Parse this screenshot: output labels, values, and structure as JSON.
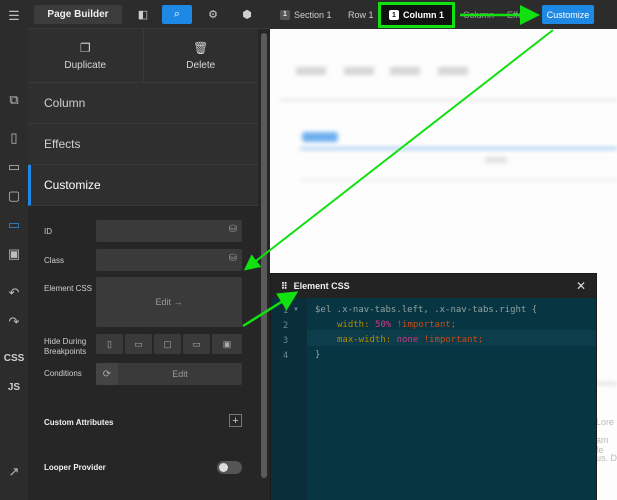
{
  "toolbar": {
    "title": "Page Builder"
  },
  "panel": {
    "actions": [
      {
        "label": "Duplicate",
        "icon": "duplicate-icon"
      },
      {
        "label": "Delete",
        "icon": "trash-icon"
      }
    ],
    "sections": [
      {
        "label": "Column"
      },
      {
        "label": "Effects"
      },
      {
        "label": "Customize"
      }
    ],
    "customize": {
      "id_label": "ID",
      "class_label": "Class",
      "css_label": "Element CSS",
      "css_edit": "Edit →",
      "hide_label": "Hide During Breakpoints",
      "conditions_label": "Conditions",
      "conditions_edit": "Edit",
      "custom_attributes": "Custom Attributes",
      "looper_provider": "Looper Provider"
    }
  },
  "rail": {
    "css": "CSS",
    "js": "JS"
  },
  "breadcrumbs": [
    {
      "num": "1",
      "label": "Section 1"
    },
    {
      "label": "Row 1"
    },
    {
      "num": "1",
      "label": "Column 1"
    },
    {
      "label": "Column"
    },
    {
      "label": "Effe"
    }
  ],
  "customize_button": "Customize",
  "editor": {
    "title": "Element CSS",
    "lines": [
      {
        "n": "1",
        "sel": "$el .x-nav-tabs.left, .x-nav-tabs.right {"
      },
      {
        "n": "2",
        "prop": "width:",
        "val": "50%",
        "imp": "!important;"
      },
      {
        "n": "3",
        "prop": "max-width:",
        "val": "none",
        "imp": "!important;"
      },
      {
        "n": "4",
        "close": "}"
      }
    ]
  },
  "canvas": {
    "text_fragments": [
      "Lore",
      "am fe",
      "us. D"
    ]
  },
  "colors": {
    "accent": "#1e88e5",
    "annotation": "#11e011",
    "panel_bg": "#2f2f2f",
    "editor_bg": "#073642"
  }
}
